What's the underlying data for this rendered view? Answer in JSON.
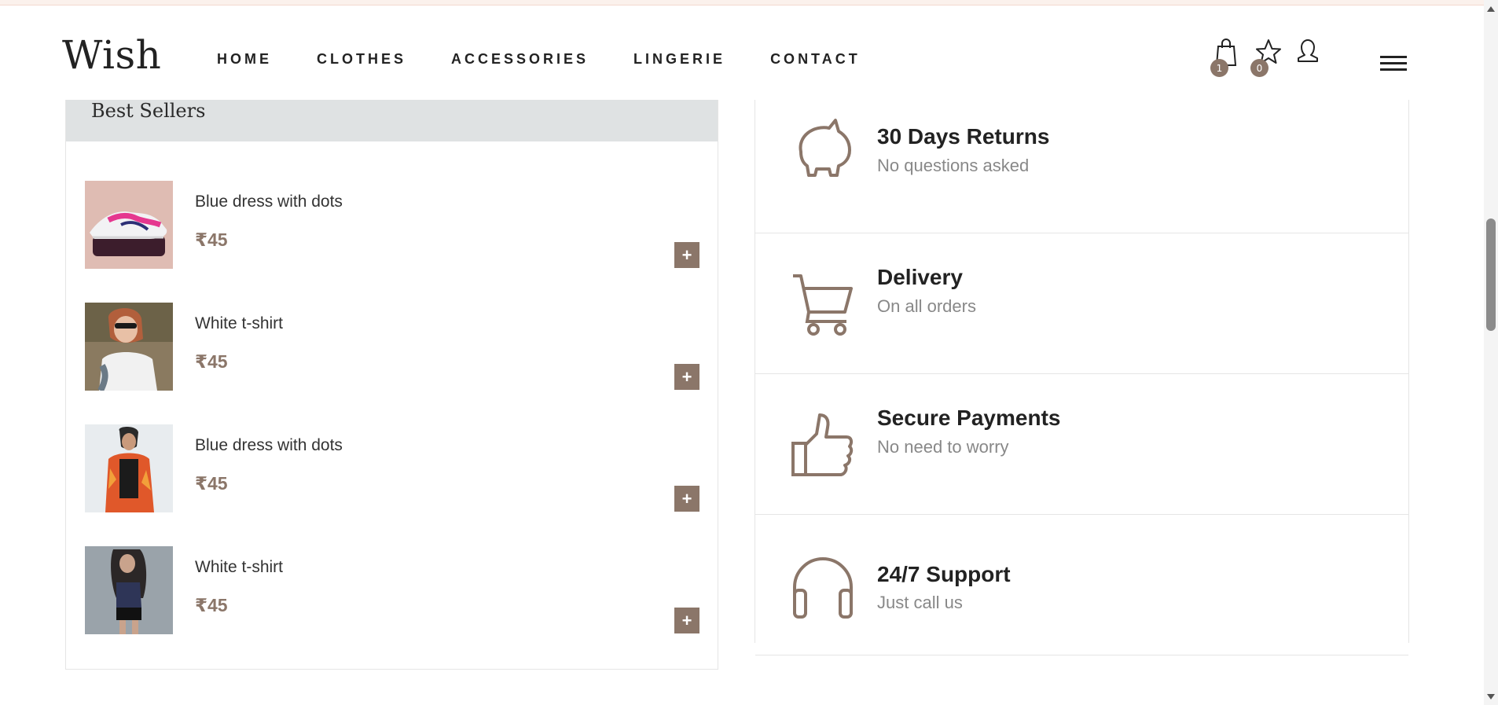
{
  "brand": {
    "logo": "Wish"
  },
  "nav": [
    {
      "label": "HOME"
    },
    {
      "label": "CLOTHES"
    },
    {
      "label": "ACCESSORIES"
    },
    {
      "label": "LINGERIE"
    },
    {
      "label": "CONTACT"
    }
  ],
  "header_icons": {
    "cart": {
      "icon": "shopping-bag-icon",
      "count": "1"
    },
    "wishlist": {
      "icon": "star-icon",
      "count": "0"
    },
    "account": {
      "icon": "user-icon"
    },
    "menu": {
      "icon": "hamburger-menu-icon"
    }
  },
  "best_sellers": {
    "title": "Best Sellers",
    "products": [
      {
        "name": "Blue dress with dots",
        "price": "₹45",
        "image": "pink-sneaker-photo",
        "add_label": "+"
      },
      {
        "name": "White t-shirt",
        "price": "₹45",
        "image": "woman-laughing-sunglasses-photo",
        "add_label": "+"
      },
      {
        "name": "Blue dress with dots",
        "price": "₹45",
        "image": "woman-orange-kimono-photo",
        "add_label": "+"
      },
      {
        "name": "White t-shirt",
        "price": "₹45",
        "image": "woman-dark-hair-grey-photo",
        "add_label": "+"
      }
    ]
  },
  "features": [
    {
      "title": "30 Days Returns",
      "subtitle": "No questions asked",
      "icon": "piggy-bank-icon"
    },
    {
      "title": "Delivery",
      "subtitle": "On all orders",
      "icon": "cart-icon"
    },
    {
      "title": "Secure Payments",
      "subtitle": "No need to worry",
      "icon": "thumbs-up-icon"
    },
    {
      "title": "24/7 Support",
      "subtitle": "Just call us",
      "icon": "headphones-icon"
    }
  ],
  "colors": {
    "accent": "#8b7669",
    "title_bar": "#dfe2e3",
    "border": "#e5e5e5",
    "muted_text": "#888888"
  }
}
